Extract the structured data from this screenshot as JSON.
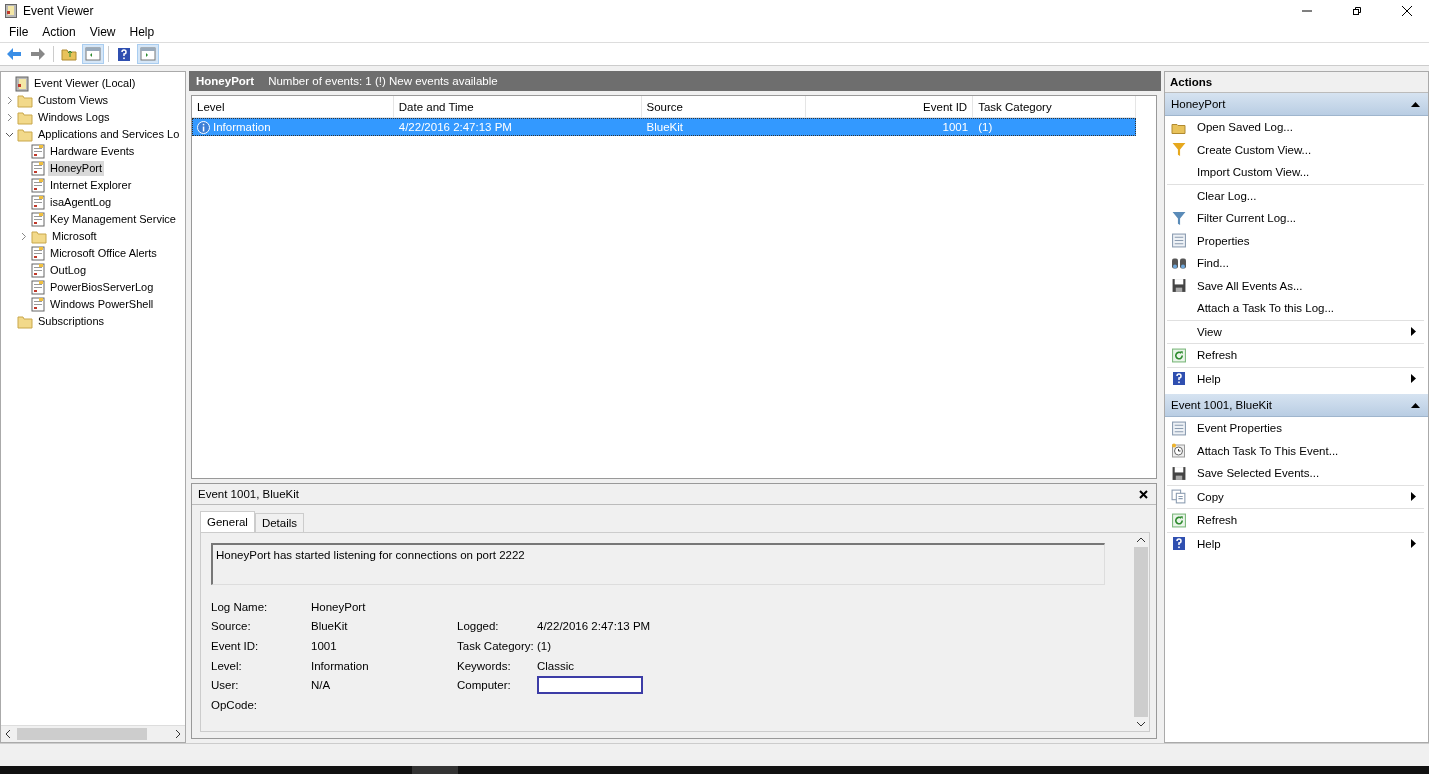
{
  "window": {
    "title": "Event Viewer"
  },
  "menu": [
    "File",
    "Action",
    "View",
    "Help"
  ],
  "tree": [
    {
      "label": "Event Viewer (Local)",
      "kind": "root",
      "selected": false,
      "children": [
        {
          "label": "Custom Views",
          "kind": "folder",
          "expanded": false,
          "selected": false
        },
        {
          "label": "Windows Logs",
          "kind": "folder",
          "expanded": false,
          "selected": false
        },
        {
          "label": "Applications and Services Lo",
          "kind": "folder",
          "expanded": true,
          "selected": false,
          "children": [
            {
              "label": "Hardware Events",
              "kind": "log",
              "selected": false
            },
            {
              "label": "HoneyPort",
              "kind": "log",
              "selected": true
            },
            {
              "label": "Internet Explorer",
              "kind": "log",
              "selected": false
            },
            {
              "label": "isaAgentLog",
              "kind": "log",
              "selected": false
            },
            {
              "label": "Key Management Service",
              "kind": "log",
              "selected": false
            },
            {
              "label": "Microsoft",
              "kind": "folder",
              "expanded": false,
              "selected": false
            },
            {
              "label": "Microsoft Office Alerts",
              "kind": "log",
              "selected": false
            },
            {
              "label": "OutLog",
              "kind": "log",
              "selected": false
            },
            {
              "label": "PowerBiosServerLog",
              "kind": "log",
              "selected": false
            },
            {
              "label": "Windows PowerShell",
              "kind": "log",
              "selected": false
            }
          ]
        },
        {
          "label": "Subscriptions",
          "kind": "folder",
          "selected": false
        }
      ]
    }
  ],
  "log_header": {
    "title": "HoneyPort",
    "summary": "Number of events: 1 (!) New events available"
  },
  "events": {
    "columns": [
      "Level",
      "Date and Time",
      "Source",
      "Event ID",
      "Task Category"
    ],
    "rows": [
      {
        "level": "Information",
        "date": "4/22/2016 2:47:13 PM",
        "source": "BlueKit",
        "event_id": "1001",
        "task_category": "(1)",
        "selected": true
      }
    ]
  },
  "detail": {
    "title": "Event 1001, BlueKit",
    "tabs": [
      {
        "label": "General",
        "selected": true
      },
      {
        "label": "Details",
        "selected": false
      }
    ],
    "message": "HoneyPort has started listening for connections on port 2222",
    "left_fields": [
      {
        "label": "Log Name:",
        "value": "HoneyPort"
      },
      {
        "label": "Source:",
        "value": "BlueKit"
      },
      {
        "label": "Event ID:",
        "value": "1001"
      },
      {
        "label": "Level:",
        "value": "Information"
      },
      {
        "label": "User:",
        "value": "N/A"
      },
      {
        "label": "OpCode:"
      }
    ],
    "right_fields": [
      {
        "label": "Logged:",
        "kind": "text",
        "value": "4/22/2016 2:47:13 PM"
      },
      {
        "label": "Task Category:",
        "kind": "text",
        "value": "(1)"
      },
      {
        "label": "Keywords:",
        "kind": "text",
        "value": "Classic"
      },
      {
        "label": "Computer:",
        "kind": "field"
      }
    ]
  },
  "actions": {
    "title": "Actions",
    "sections": [
      {
        "title": "HoneyPort",
        "expanded": true,
        "groups": [
          [
            {
              "label": "Open Saved Log...",
              "kind": "folder",
              "submenu": false
            },
            {
              "label": "Create Custom View...",
              "kind": "funnel-gold",
              "submenu": false
            },
            {
              "label": "Import Custom View...",
              "kind": "plain",
              "submenu": false
            }
          ],
          [
            {
              "label": "Clear Log...",
              "kind": "plain",
              "submenu": false
            },
            {
              "label": "Filter Current Log...",
              "kind": "funnel",
              "submenu": false
            },
            {
              "label": "Properties",
              "kind": "properties",
              "submenu": false
            },
            {
              "label": "Find...",
              "kind": "binoculars",
              "submenu": false
            },
            {
              "label": "Save All Events As...",
              "kind": "save",
              "submenu": false
            },
            {
              "label": "Attach a Task To this Log...",
              "kind": "plain",
              "submenu": false
            }
          ],
          [
            {
              "label": "View",
              "kind": "plain",
              "submenu": true
            }
          ],
          [
            {
              "label": "Refresh",
              "kind": "refresh",
              "submenu": false
            }
          ],
          [
            {
              "label": "Help",
              "kind": "help",
              "submenu": true
            }
          ]
        ]
      },
      {
        "title": "Event 1001, BlueKit",
        "expanded": true,
        "groups": [
          [
            {
              "label": "Event Properties",
              "kind": "properties",
              "submenu": false
            },
            {
              "label": "Attach Task To This Event...",
              "kind": "clock",
              "submenu": false
            },
            {
              "label": "Save Selected Events...",
              "kind": "save",
              "submenu": false
            }
          ],
          [
            {
              "label": "Copy",
              "kind": "copy",
              "submenu": true
            }
          ],
          [
            {
              "label": "Refresh",
              "kind": "refresh",
              "submenu": false
            }
          ],
          [
            {
              "label": "Help",
              "kind": "help",
              "submenu": true
            }
          ]
        ]
      }
    ]
  }
}
